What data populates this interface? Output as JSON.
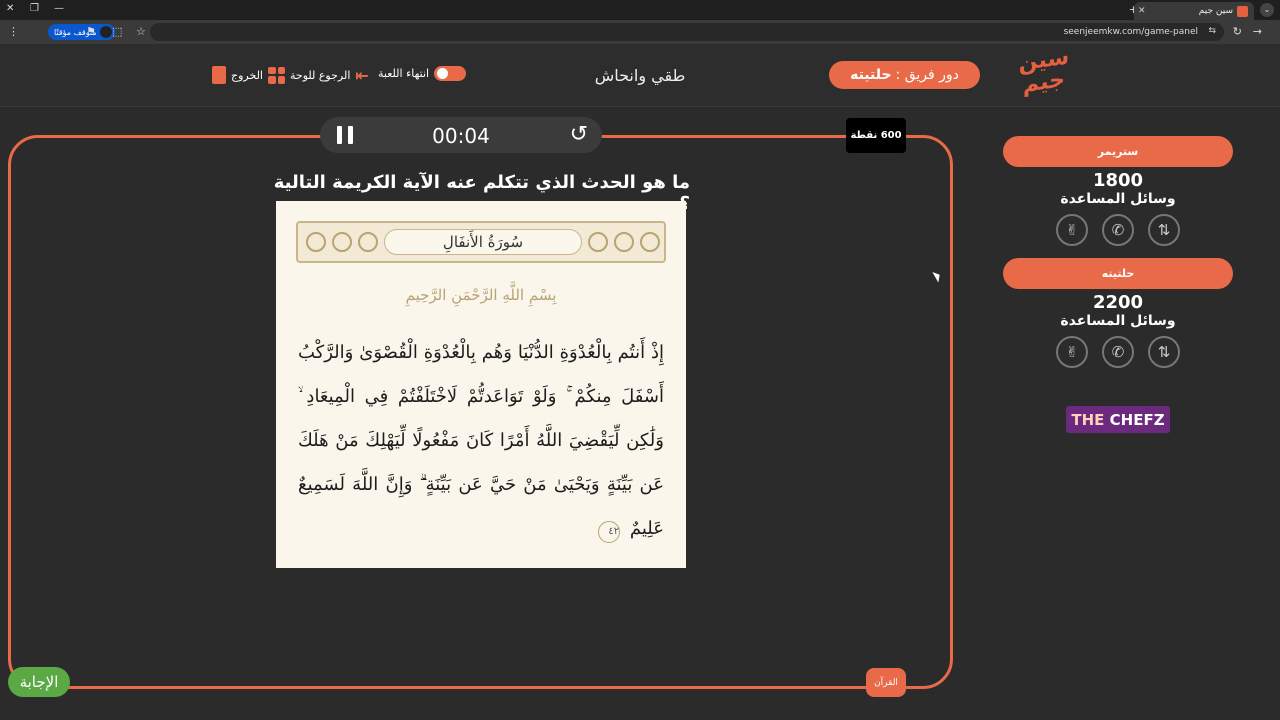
{
  "browser": {
    "tab_title": "سين جيم",
    "new_tab_symbol": "+",
    "tab_close_symbol": "✕",
    "url": "seenjeemkw.com/game-panel",
    "paused_label": "متوقف مؤقتًا",
    "window_close": "✕",
    "window_restore": "❐",
    "window_minimize": "—"
  },
  "header": {
    "logo_text": "سين جيم",
    "turn_prefix": "دور فريق :",
    "turn_team": "حلتيته",
    "game_name": "طقي وانحاش",
    "end_game_label": "انتهاء اللعبة",
    "back_to_board_label": "الرجوع للوحة",
    "exit_label": "الخروج"
  },
  "timer": {
    "time": "00:04"
  },
  "points_badge": "600 نقطة",
  "question": {
    "text": "ما هو الحدث الذي تتكلم عنه الآية الكريمة التالية ؟",
    "surah_title": "سُورَةُ الأَنفَالِ",
    "basmala": "بِسْمِ اللَّهِ الرَّحْمَنِ الرَّحِيمِ",
    "verse": "إِذْ أَنتُم بِالْعُدْوَةِ الدُّنْيَا وَهُم بِالْعُدْوَةِ الْقُصْوَىٰ وَالرَّكْبُ أَسْفَلَ مِنكُمْ ۚ وَلَوْ تَوَاعَدتُّمْ لَاخْتَلَفْتُمْ فِي الْمِيعَادِ ۙ وَلَٰكِن لِّيَقْضِيَ اللَّهُ أَمْرًا كَانَ مَفْعُولًا لِّيَهْلِكَ مَنْ هَلَكَ عَن بَيِّنَةٍ وَيَحْيَىٰ مَنْ حَيَّ عَن بَيِّنَةٍ ۗ وَإِنَّ اللَّهَ لَسَمِيعٌ عَلِيمٌ",
    "verse_number": "٤٢"
  },
  "teams": [
    {
      "name": "ستريمر",
      "score": "1800",
      "aids_label": "وسائل المساعدة"
    },
    {
      "name": "حلتيته",
      "score": "2200",
      "aids_label": "وسائل المساعدة"
    }
  ],
  "sponsor": {
    "part1": "THE",
    "part2": "CHEFZ"
  },
  "answer_button": "الإجابة",
  "category_tag": "القرآن",
  "colors": {
    "accent": "#e86a48",
    "answer": "#5aa945",
    "background": "#2b2b2b"
  }
}
